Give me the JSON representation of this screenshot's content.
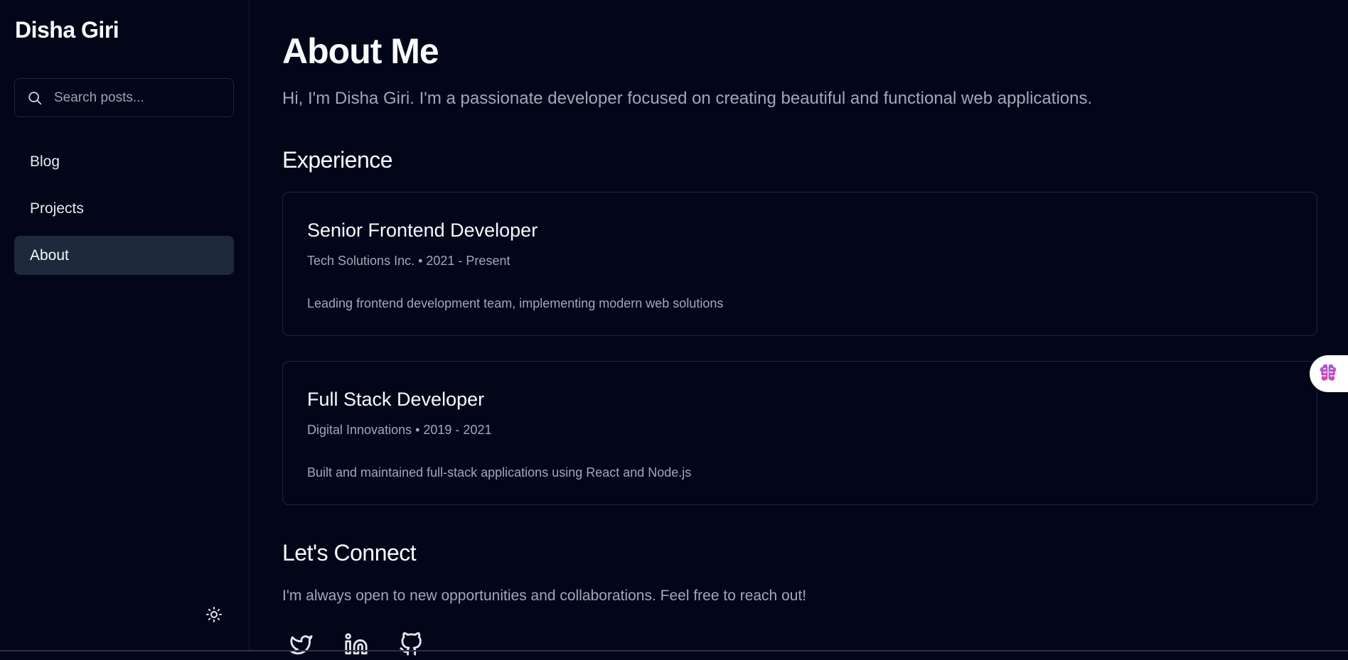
{
  "sidebar": {
    "brand": "Disha Giri",
    "search": {
      "placeholder": "Search posts...",
      "icon": "search-icon"
    },
    "nav": [
      {
        "label": "Blog",
        "active": false
      },
      {
        "label": "Projects",
        "active": false
      },
      {
        "label": "About",
        "active": true
      }
    ],
    "theme_toggle_icon": "sun-icon"
  },
  "main": {
    "title": "About Me",
    "intro": "Hi, I'm Disha Giri. I'm a passionate developer focused on creating beautiful and functional web applications.",
    "experience": {
      "heading": "Experience",
      "items": [
        {
          "role": "Senior Frontend Developer",
          "company": "Tech Solutions Inc.",
          "period": "2021 - Present",
          "meta": "Tech Solutions Inc. • 2021 - Present",
          "description": "Leading frontend development team, implementing modern web solutions"
        },
        {
          "role": "Full Stack Developer",
          "company": "Digital Innovations",
          "period": "2019 - 2021",
          "meta": "Digital Innovations • 2019 - 2021",
          "description": "Built and maintained full-stack applications using React and Node.js"
        }
      ]
    },
    "connect": {
      "heading": "Let's Connect",
      "text": "I'm always open to new opportunities and collaborations. Feel free to reach out!",
      "links": [
        "twitter-icon",
        "linkedin-icon",
        "github-icon"
      ]
    }
  },
  "floating_widget": {
    "icon": "brain-icon"
  },
  "colors": {
    "background": "#030619",
    "border": "#1f2637",
    "active_nav": "#1e293b",
    "muted_text": "#a0a8b8",
    "text": "#f8fafc"
  }
}
